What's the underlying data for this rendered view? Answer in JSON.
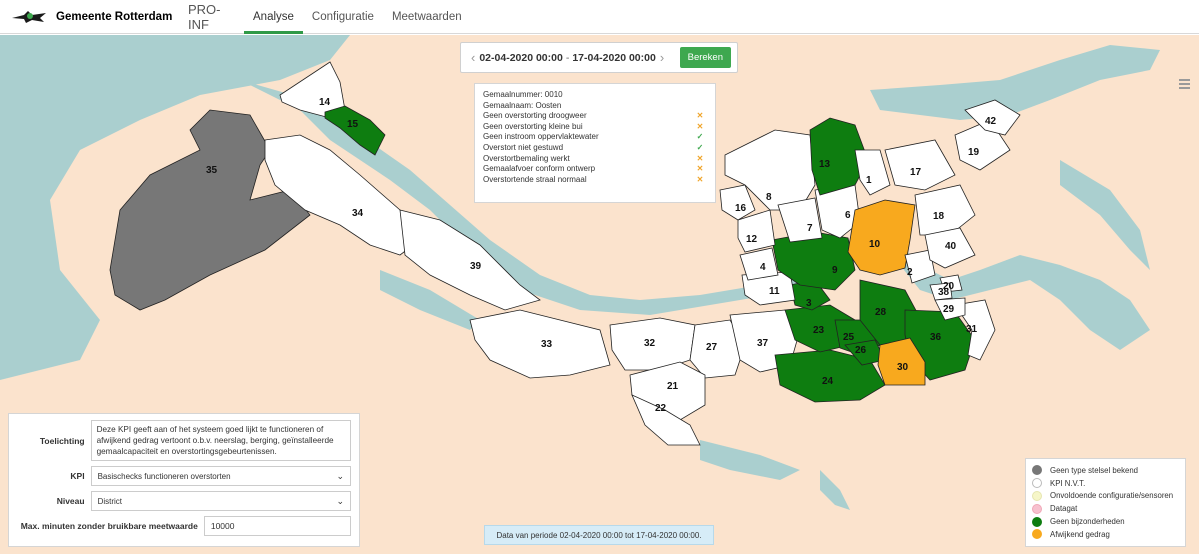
{
  "header": {
    "municipality": "Gemeente Rotterdam",
    "product": "PRO-INF",
    "tabs": [
      {
        "label": "Analyse",
        "active": true
      },
      {
        "label": "Configuratie",
        "active": false
      },
      {
        "label": "Meetwaarden",
        "active": false
      }
    ]
  },
  "period": {
    "start": "02-04-2020 00:00",
    "separator": "-",
    "end": "17-04-2020 00:00",
    "calculate_label": "Bereken"
  },
  "info": {
    "rows": [
      {
        "text": "Gemaalnummer: 0010",
        "status": ""
      },
      {
        "text": "Gemaalnaam: Oosten",
        "status": ""
      },
      {
        "text": "Geen overstorting droogweer",
        "status": "x"
      },
      {
        "text": "Geen overstorting kleine bui",
        "status": "x"
      },
      {
        "text": "Geen instroom oppervlaktewater",
        "status": "check"
      },
      {
        "text": "Overstort niet gestuwd",
        "status": "check"
      },
      {
        "text": "Overstortbemaling werkt",
        "status": "x"
      },
      {
        "text": "Gemaalafvoer conform ontwerp",
        "status": "x"
      },
      {
        "text": "Overstortende straal normaal",
        "status": "x"
      }
    ]
  },
  "controls": {
    "toelichting_label": "Toelichting",
    "toelichting_text": "Deze KPI geeft aan of het systeem goed lijkt te functioneren of afwijkend gedrag vertoont o.b.v. neerslag, berging, geïnstalleerde gemaalcapaciteit en overstortingsgebeurtenissen.",
    "kpi_label": "KPI",
    "kpi_value": "Basischecks functioneren overstorten",
    "niveau_label": "Niveau",
    "niveau_value": "District",
    "max_minutes_label": "Max. minuten zonder bruikbare meetwaarde",
    "max_minutes_value": "10000"
  },
  "status_text": "Data van periode 02-04-2020 00:00 tot 17-04-2020 00:00.",
  "legend": [
    {
      "label": "Geen type stelsel bekend",
      "color": "#777777"
    },
    {
      "label": "KPI N.V.T.",
      "color": "#ffffff"
    },
    {
      "label": "Onvoldoende configuratie/sensoren",
      "color": "#f6f6c8"
    },
    {
      "label": "Datagat",
      "color": "#f7c1cf"
    },
    {
      "label": "Geen bijzonderheden",
      "color": "#0e7d10"
    },
    {
      "label": "Afwijkend gedrag",
      "color": "#f8a91e"
    }
  ],
  "colors": {
    "water": "#aacfcf",
    "land": "#fbe3cd",
    "ok": "#0e7d10",
    "deviant": "#f8a91e",
    "unknown": "#777777",
    "accent": "#3ea84f"
  },
  "districts": [
    {
      "id": "1",
      "status": "nvt"
    },
    {
      "id": "2",
      "status": "nvt"
    },
    {
      "id": "3",
      "status": "ok"
    },
    {
      "id": "4",
      "status": "nvt"
    },
    {
      "id": "6",
      "status": "nvt"
    },
    {
      "id": "7",
      "status": "nvt"
    },
    {
      "id": "8",
      "status": "nvt"
    },
    {
      "id": "9",
      "status": "ok"
    },
    {
      "id": "10",
      "status": "deviant"
    },
    {
      "id": "11",
      "status": "nvt"
    },
    {
      "id": "12",
      "status": "nvt"
    },
    {
      "id": "13",
      "status": "ok"
    },
    {
      "id": "14",
      "status": "nvt"
    },
    {
      "id": "15",
      "status": "ok"
    },
    {
      "id": "16",
      "status": "nvt"
    },
    {
      "id": "17",
      "status": "nvt"
    },
    {
      "id": "18",
      "status": "nvt"
    },
    {
      "id": "19",
      "status": "nvt"
    },
    {
      "id": "20",
      "status": "nvt"
    },
    {
      "id": "21",
      "status": "nvt"
    },
    {
      "id": "22",
      "status": "nvt"
    },
    {
      "id": "23",
      "status": "ok"
    },
    {
      "id": "24",
      "status": "ok"
    },
    {
      "id": "25",
      "status": "ok"
    },
    {
      "id": "26",
      "status": "ok"
    },
    {
      "id": "27",
      "status": "nvt"
    },
    {
      "id": "28",
      "status": "ok"
    },
    {
      "id": "29",
      "status": "nvt"
    },
    {
      "id": "30",
      "status": "deviant"
    },
    {
      "id": "31",
      "status": "nvt"
    },
    {
      "id": "32",
      "status": "nvt"
    },
    {
      "id": "33",
      "status": "nvt"
    },
    {
      "id": "34",
      "status": "nvt"
    },
    {
      "id": "35",
      "status": "unknown"
    },
    {
      "id": "36",
      "status": "ok"
    },
    {
      "id": "37",
      "status": "nvt"
    },
    {
      "id": "38",
      "status": "nvt"
    },
    {
      "id": "39",
      "status": "nvt"
    },
    {
      "id": "40",
      "status": "nvt"
    },
    {
      "id": "42",
      "status": "nvt"
    }
  ]
}
